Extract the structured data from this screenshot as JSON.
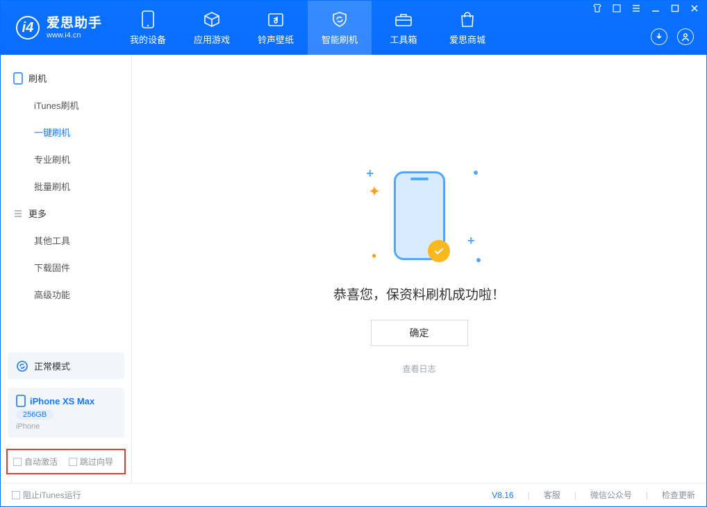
{
  "brand": {
    "name": "爱思助手",
    "url": "www.i4.cn"
  },
  "nav": {
    "tabs": [
      {
        "label": "我的设备"
      },
      {
        "label": "应用游戏"
      },
      {
        "label": "铃声壁纸"
      },
      {
        "label": "智能刷机"
      },
      {
        "label": "工具箱"
      },
      {
        "label": "爱思商城"
      }
    ]
  },
  "sidebar": {
    "section1": {
      "title": "刷机",
      "items": [
        "iTunes刷机",
        "一键刷机",
        "专业刷机",
        "批量刷机"
      ]
    },
    "section2": {
      "title": "更多",
      "items": [
        "其他工具",
        "下载固件",
        "高级功能"
      ]
    },
    "mode": {
      "label": "正常模式"
    },
    "device": {
      "name": "iPhone XS Max",
      "capacity": "256GB",
      "type": "iPhone"
    },
    "options": {
      "auto_activate": "自动激活",
      "skip_guide": "跳过向导"
    }
  },
  "main": {
    "success_text": "恭喜您，保资料刷机成功啦！",
    "ok_label": "确定",
    "log_link": "查看日志"
  },
  "footer": {
    "block_itunes": "阻止iTunes运行",
    "version": "V8.16",
    "links": [
      "客服",
      "微信公众号",
      "检查更新"
    ]
  }
}
